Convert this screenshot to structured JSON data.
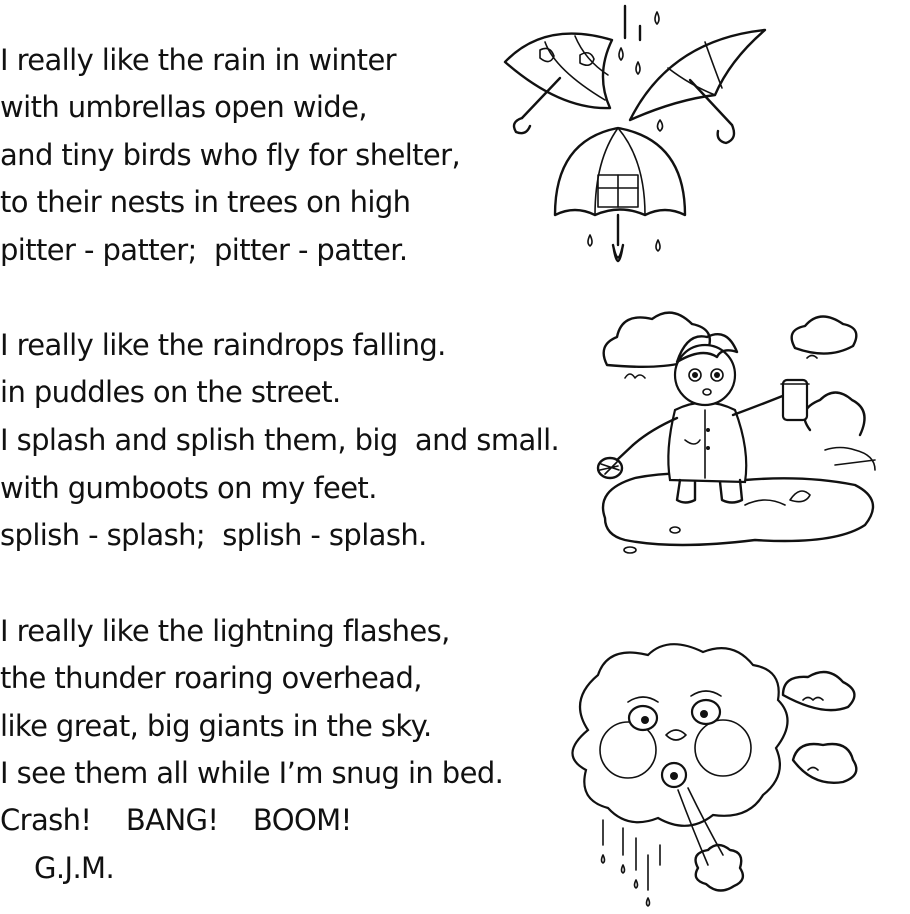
{
  "stanzas": [
    {
      "lines": [
        "I really like the rain in winter",
        "with umbrellas open wide,",
        "and tiny birds who fly for shelter,",
        "to their nests in trees on high",
        "pitter - patter;  pitter - patter."
      ]
    },
    {
      "lines": [
        "I really like the raindrops falling.",
        "in puddles on the street.",
        "I splash and splish them, big  and small.",
        "with gumboots on my feet.",
        "splish - splash;  splish - splash."
      ]
    },
    {
      "lines": [
        "I really like the lightning flashes,",
        "the thunder roaring overhead,",
        "like great, big giants in the sky.",
        "I see them all while I’m snug in bed.",
        "Crash!    BANG!    BOOM!"
      ]
    }
  ],
  "signature": "G.J.M.",
  "illustrations": {
    "umbrellas": "umbrellas-in-rain-icon",
    "child": "child-in-puddle-icon",
    "cloud": "blowing-storm-cloud-icon"
  }
}
